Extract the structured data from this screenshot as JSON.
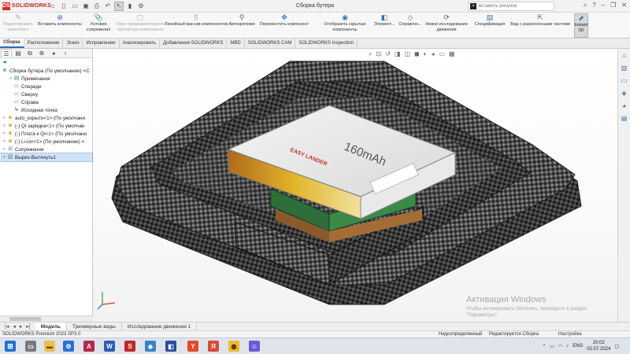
{
  "app": {
    "logo_mark": "DS",
    "logo_text": "SOLIDWORKS",
    "document_title": "Сборка бутера"
  },
  "search": {
    "placeholder": "вставить рисунок"
  },
  "ribbon": {
    "buttons": [
      {
        "label": "Редактировать\nкомпонент",
        "icon": "edit-component-icon",
        "enabled": false
      },
      {
        "label": "Вставить компоненты",
        "icon": "insert-components-icon",
        "enabled": true
      },
      {
        "label": "Условия\nсопряжения",
        "icon": "mate-icon",
        "enabled": true
      },
      {
        "label": "Окно предварительного\nпросмотра компонента",
        "icon": "preview-window-icon",
        "enabled": false
      },
      {
        "label": "Линейный массив компонентов",
        "icon": "linear-pattern-icon",
        "enabled": true
      },
      {
        "label": "Автокрепежи",
        "icon": "smart-fasteners-icon",
        "enabled": true
      },
      {
        "label": "Переместить компонент",
        "icon": "move-component-icon",
        "enabled": true
      },
      {
        "label": "Отобразить скрытые\nкомпоненты",
        "icon": "show-hidden-icon",
        "enabled": true
      },
      {
        "label": "Элемент...",
        "icon": "assembly-feature-icon",
        "enabled": true
      },
      {
        "label": "Справочн...",
        "icon": "reference-geometry-icon",
        "enabled": true
      },
      {
        "label": "Новое исследование\nдвижения",
        "icon": "motion-study-icon",
        "enabled": true
      },
      {
        "label": "Спецификация",
        "icon": "bill-of-materials-icon",
        "enabled": true
      },
      {
        "label": "Вид с разнесенными частями",
        "icon": "exploded-view-icon",
        "enabled": true
      },
      {
        "label": "Instant\n3D",
        "icon": "instant-3d-icon",
        "enabled": true,
        "active": true
      }
    ]
  },
  "tabs": [
    "Сборка",
    "Расположение",
    "Эскиз",
    "Исправление",
    "Анализировать",
    "Добавления SOLIDWORKS",
    "MBD",
    "SOLIDWORKS CAM",
    "SOLIDWORKS Inspection"
  ],
  "tree": {
    "root": "Сборка бутера  (По умолчанию) <С",
    "items": [
      {
        "label": "Примечания",
        "icon": "annotations-icon",
        "expand": ">"
      },
      {
        "label": "Спереди",
        "icon": "plane-icon",
        "expand": ""
      },
      {
        "label": "Сверху",
        "icon": "plane-icon",
        "expand": ""
      },
      {
        "label": "Справа",
        "icon": "plane-icon",
        "expand": ""
      },
      {
        "label": "Исходная точка",
        "icon": "origin-icon",
        "expand": ""
      },
      {
        "label": "auto_корыто<1> (По умолчани",
        "icon": "part-icon",
        "expand": ">"
      },
      {
        "label": "(-) Qi зарядка<1> (По умолчан",
        "icon": "part-icon",
        "expand": ">"
      },
      {
        "label": "(-) Плата к Qi<1> (По умолчани",
        "icon": "part-icon",
        "expand": ">"
      },
      {
        "label": "(-) Li-ion<1> (По умолчанию) <",
        "icon": "part-icon",
        "expand": ">"
      },
      {
        "label": "Сопряжения",
        "icon": "mates-folder-icon",
        "expand": ">"
      },
      {
        "label": "Вырез-Вытянуть1",
        "icon": "cut-extrude-icon",
        "expand": ">",
        "selected": true
      }
    ]
  },
  "bottom_tabs": [
    "Модель",
    "Трехмерные виды",
    "Исследование движения 1"
  ],
  "status": {
    "product": "SOLIDWORKS Premium 2023 SP3.0",
    "state": "Недоопределенный",
    "mode": "Редактируется Сборка",
    "settings": "Настройка"
  },
  "battery_label": "160mAh",
  "battery_brand": "EASY LANDER",
  "watermark": {
    "title": "Активация Windows",
    "subtitle": "Чтобы активировать Windows, перейдите в раздел\n\"Параметры\"."
  },
  "taskbar": {
    "lang": "ENG",
    "time": "20:02",
    "date": "02.07.2024"
  },
  "colors": {
    "accent": "#2a6bc2",
    "brand": "#d8282c"
  }
}
